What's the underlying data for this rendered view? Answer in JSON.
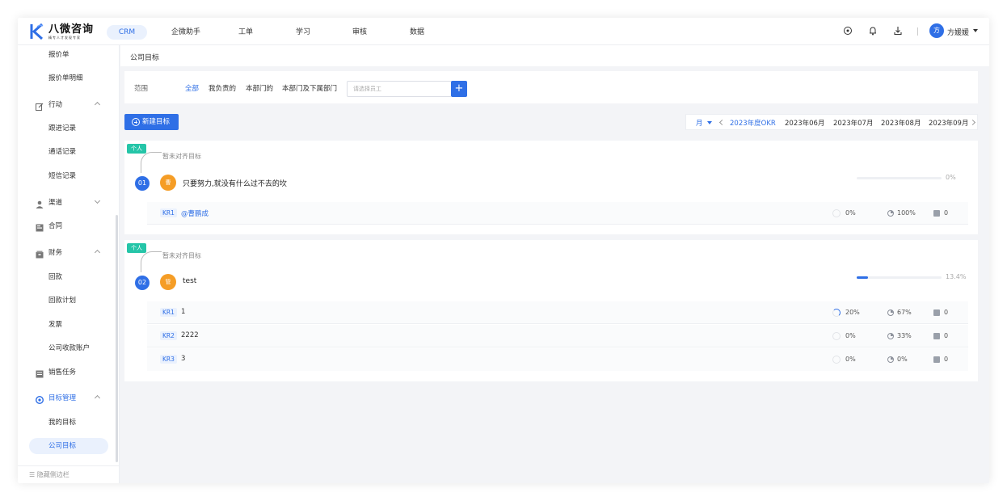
{
  "brand": {
    "title": "八微咨询",
    "subtitle": "精专人才发现专家"
  },
  "topnav": {
    "items": [
      "CRM",
      "企微助手",
      "工单",
      "学习",
      "审核",
      "数据"
    ],
    "active": "CRM",
    "user": {
      "avatar_char": "方",
      "name": "方媛媛"
    }
  },
  "sidebar": {
    "items": [
      {
        "label": "报价单",
        "type": "sub"
      },
      {
        "label": "报价单明细",
        "type": "sub"
      },
      {
        "label": "行动",
        "type": "group",
        "icon": "edit-icon",
        "expanded": true
      },
      {
        "label": "跟进记录",
        "type": "sub"
      },
      {
        "label": "通话记录",
        "type": "sub"
      },
      {
        "label": "短信记录",
        "type": "sub"
      },
      {
        "label": "渠道",
        "type": "group",
        "icon": "user-icon",
        "expanded": false
      },
      {
        "label": "合同",
        "type": "group",
        "icon": "contract-icon"
      },
      {
        "label": "财务",
        "type": "group",
        "icon": "wallet-icon",
        "expanded": true
      },
      {
        "label": "回款",
        "type": "sub"
      },
      {
        "label": "回款计划",
        "type": "sub"
      },
      {
        "label": "发票",
        "type": "sub"
      },
      {
        "label": "公司收款账户",
        "type": "sub"
      },
      {
        "label": "销售任务",
        "type": "group",
        "icon": "task-icon"
      },
      {
        "label": "目标管理",
        "type": "group",
        "icon": "target-icon",
        "expanded": true
      },
      {
        "label": "我的目标",
        "type": "sub"
      },
      {
        "label": "公司目标",
        "type": "sub"
      }
    ],
    "footer": "隐藏侧边栏"
  },
  "breadcrumb": "公司目标",
  "filter": {
    "label": "范围",
    "options": [
      "全部",
      "我负责的",
      "本部门的",
      "本部门及下属部门"
    ],
    "active": "全部",
    "employee_placeholder": "请选择员工",
    "add_label": "+"
  },
  "new_goal_label": "新建目标",
  "period": {
    "unit": "月",
    "items": [
      "2023年度OKR",
      "2023年06月",
      "2023年07月",
      "2023年08月",
      "2023年09月"
    ],
    "active": "2023年度OKR"
  },
  "goals": [
    {
      "tag": "个人",
      "align_text": "暂未对齐目标",
      "number": "01",
      "owner_char": "曹",
      "title": "只要努力,就没有什么过不去的坎",
      "progress": 0,
      "progress_label": "0%",
      "krs": [
        {
          "tag": "KR1",
          "text": "@曹鹏成",
          "is_mention": true,
          "progress": "0%",
          "progress_frac": 0,
          "confidence": "100%",
          "count": "0"
        }
      ]
    },
    {
      "tag": "个人",
      "align_text": "暂未对齐目标",
      "number": "02",
      "owner_char": "管",
      "title": "test",
      "progress": 13.4,
      "progress_label": "13.4%",
      "krs": [
        {
          "tag": "KR1",
          "text": "1",
          "is_mention": false,
          "progress": "20%",
          "progress_frac": 0.2,
          "confidence": "67%",
          "count": "0"
        },
        {
          "tag": "KR2",
          "text": "2222",
          "is_mention": false,
          "progress": "0%",
          "progress_frac": 0,
          "confidence": "33%",
          "count": "0"
        },
        {
          "tag": "KR3",
          "text": "3",
          "is_mention": false,
          "progress": "0%",
          "progress_frac": 0,
          "confidence": "0%",
          "count": "0"
        }
      ]
    }
  ],
  "colors": {
    "accent": "#2f6fe6",
    "tag_green": "#25c5a8",
    "avatar_orange": "#f59d26"
  }
}
